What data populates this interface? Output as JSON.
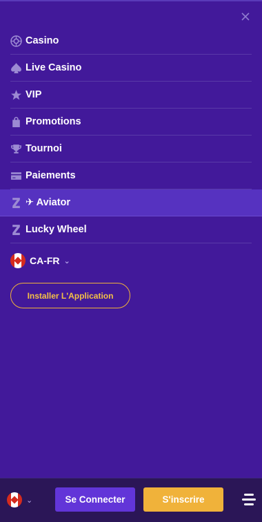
{
  "menu": {
    "items": [
      {
        "label": "Casino",
        "icon": "roulette-icon"
      },
      {
        "label": "Live Casino",
        "icon": "spade-icon"
      },
      {
        "label": "VIP",
        "icon": "star-icon"
      },
      {
        "label": "Promotions",
        "icon": "bag-icon"
      },
      {
        "label": "Tournoi",
        "icon": "trophy-icon"
      },
      {
        "label": "Paiements",
        "icon": "card-icon"
      },
      {
        "label": "✈ Aviator",
        "icon": "z-icon",
        "active": true
      },
      {
        "label": "Lucky Wheel",
        "icon": "z-icon"
      }
    ]
  },
  "locale": {
    "code": "CA-FR",
    "flag": "canada-flag-icon"
  },
  "install_label": "Installer L'Application",
  "footer": {
    "login_label": "Se Connecter",
    "signup_label": "S'inscrire"
  },
  "colors": {
    "drawer_bg": "#42199a",
    "active_item_bg": "#5632c0",
    "accent_gold": "#f0b23a",
    "login_btn": "#6235d8"
  }
}
